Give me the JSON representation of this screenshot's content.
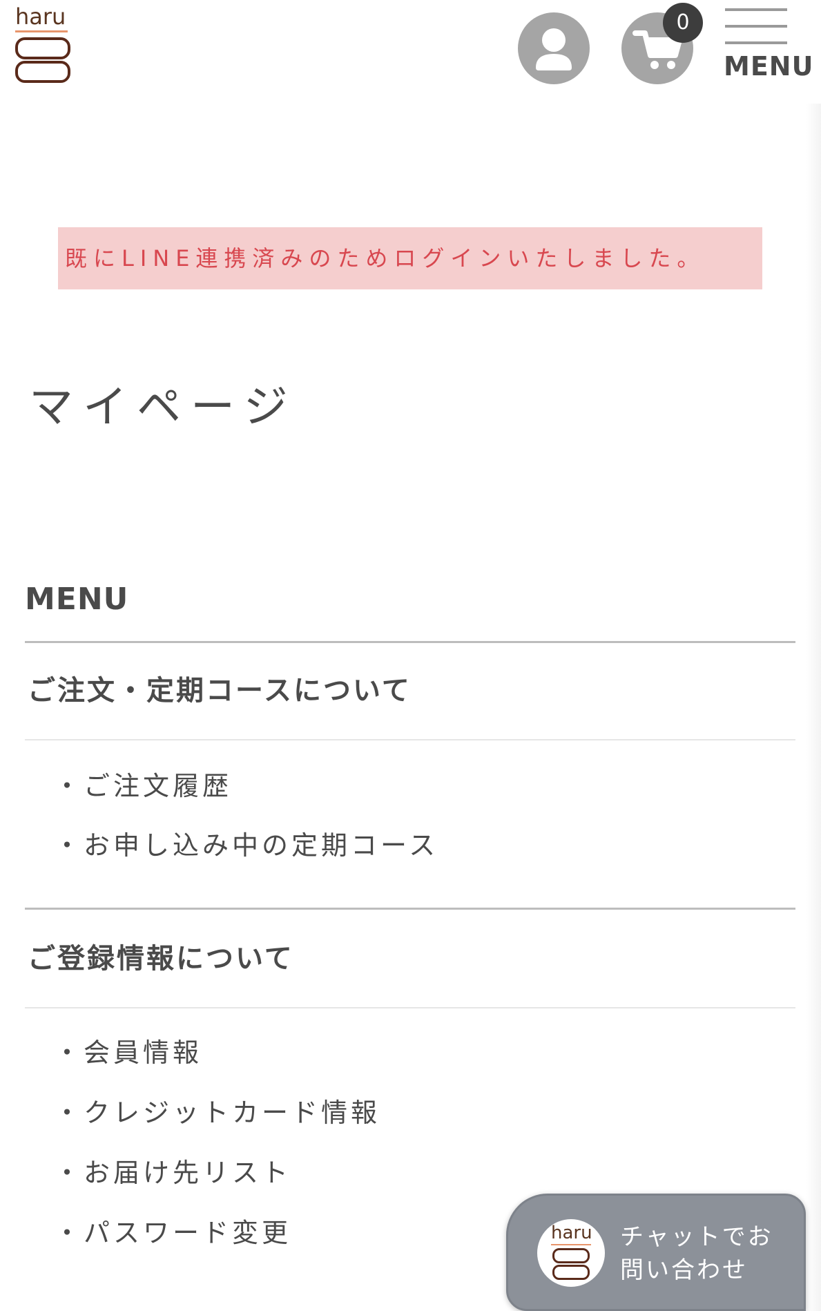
{
  "header": {
    "logo_text": "haru",
    "cart_count": "0",
    "menu_label": "MENU"
  },
  "alert": {
    "message": "既にLINE連携済みのためログインいたしました。"
  },
  "page": {
    "title": "マイページ"
  },
  "menu": {
    "heading": "MENU",
    "groups": [
      {
        "heading": "ご注文・定期コースについて",
        "links": [
          "・ご注文履歴",
          "・お申し込み中の定期コース"
        ]
      },
      {
        "heading": "ご登録情報について",
        "links": [
          "・会員情報",
          "・クレジットカード情報",
          "・お届け先リスト",
          "・パスワード変更"
        ]
      }
    ]
  },
  "chat": {
    "logo_text": "haru",
    "line1": "チャットでお",
    "line2": "問い合わせ"
  },
  "colors": {
    "alert_bg": "#f5cece",
    "alert_text": "#d8474f",
    "icon_gray": "#a5a5a5",
    "chat_bg": "#8c9199"
  }
}
